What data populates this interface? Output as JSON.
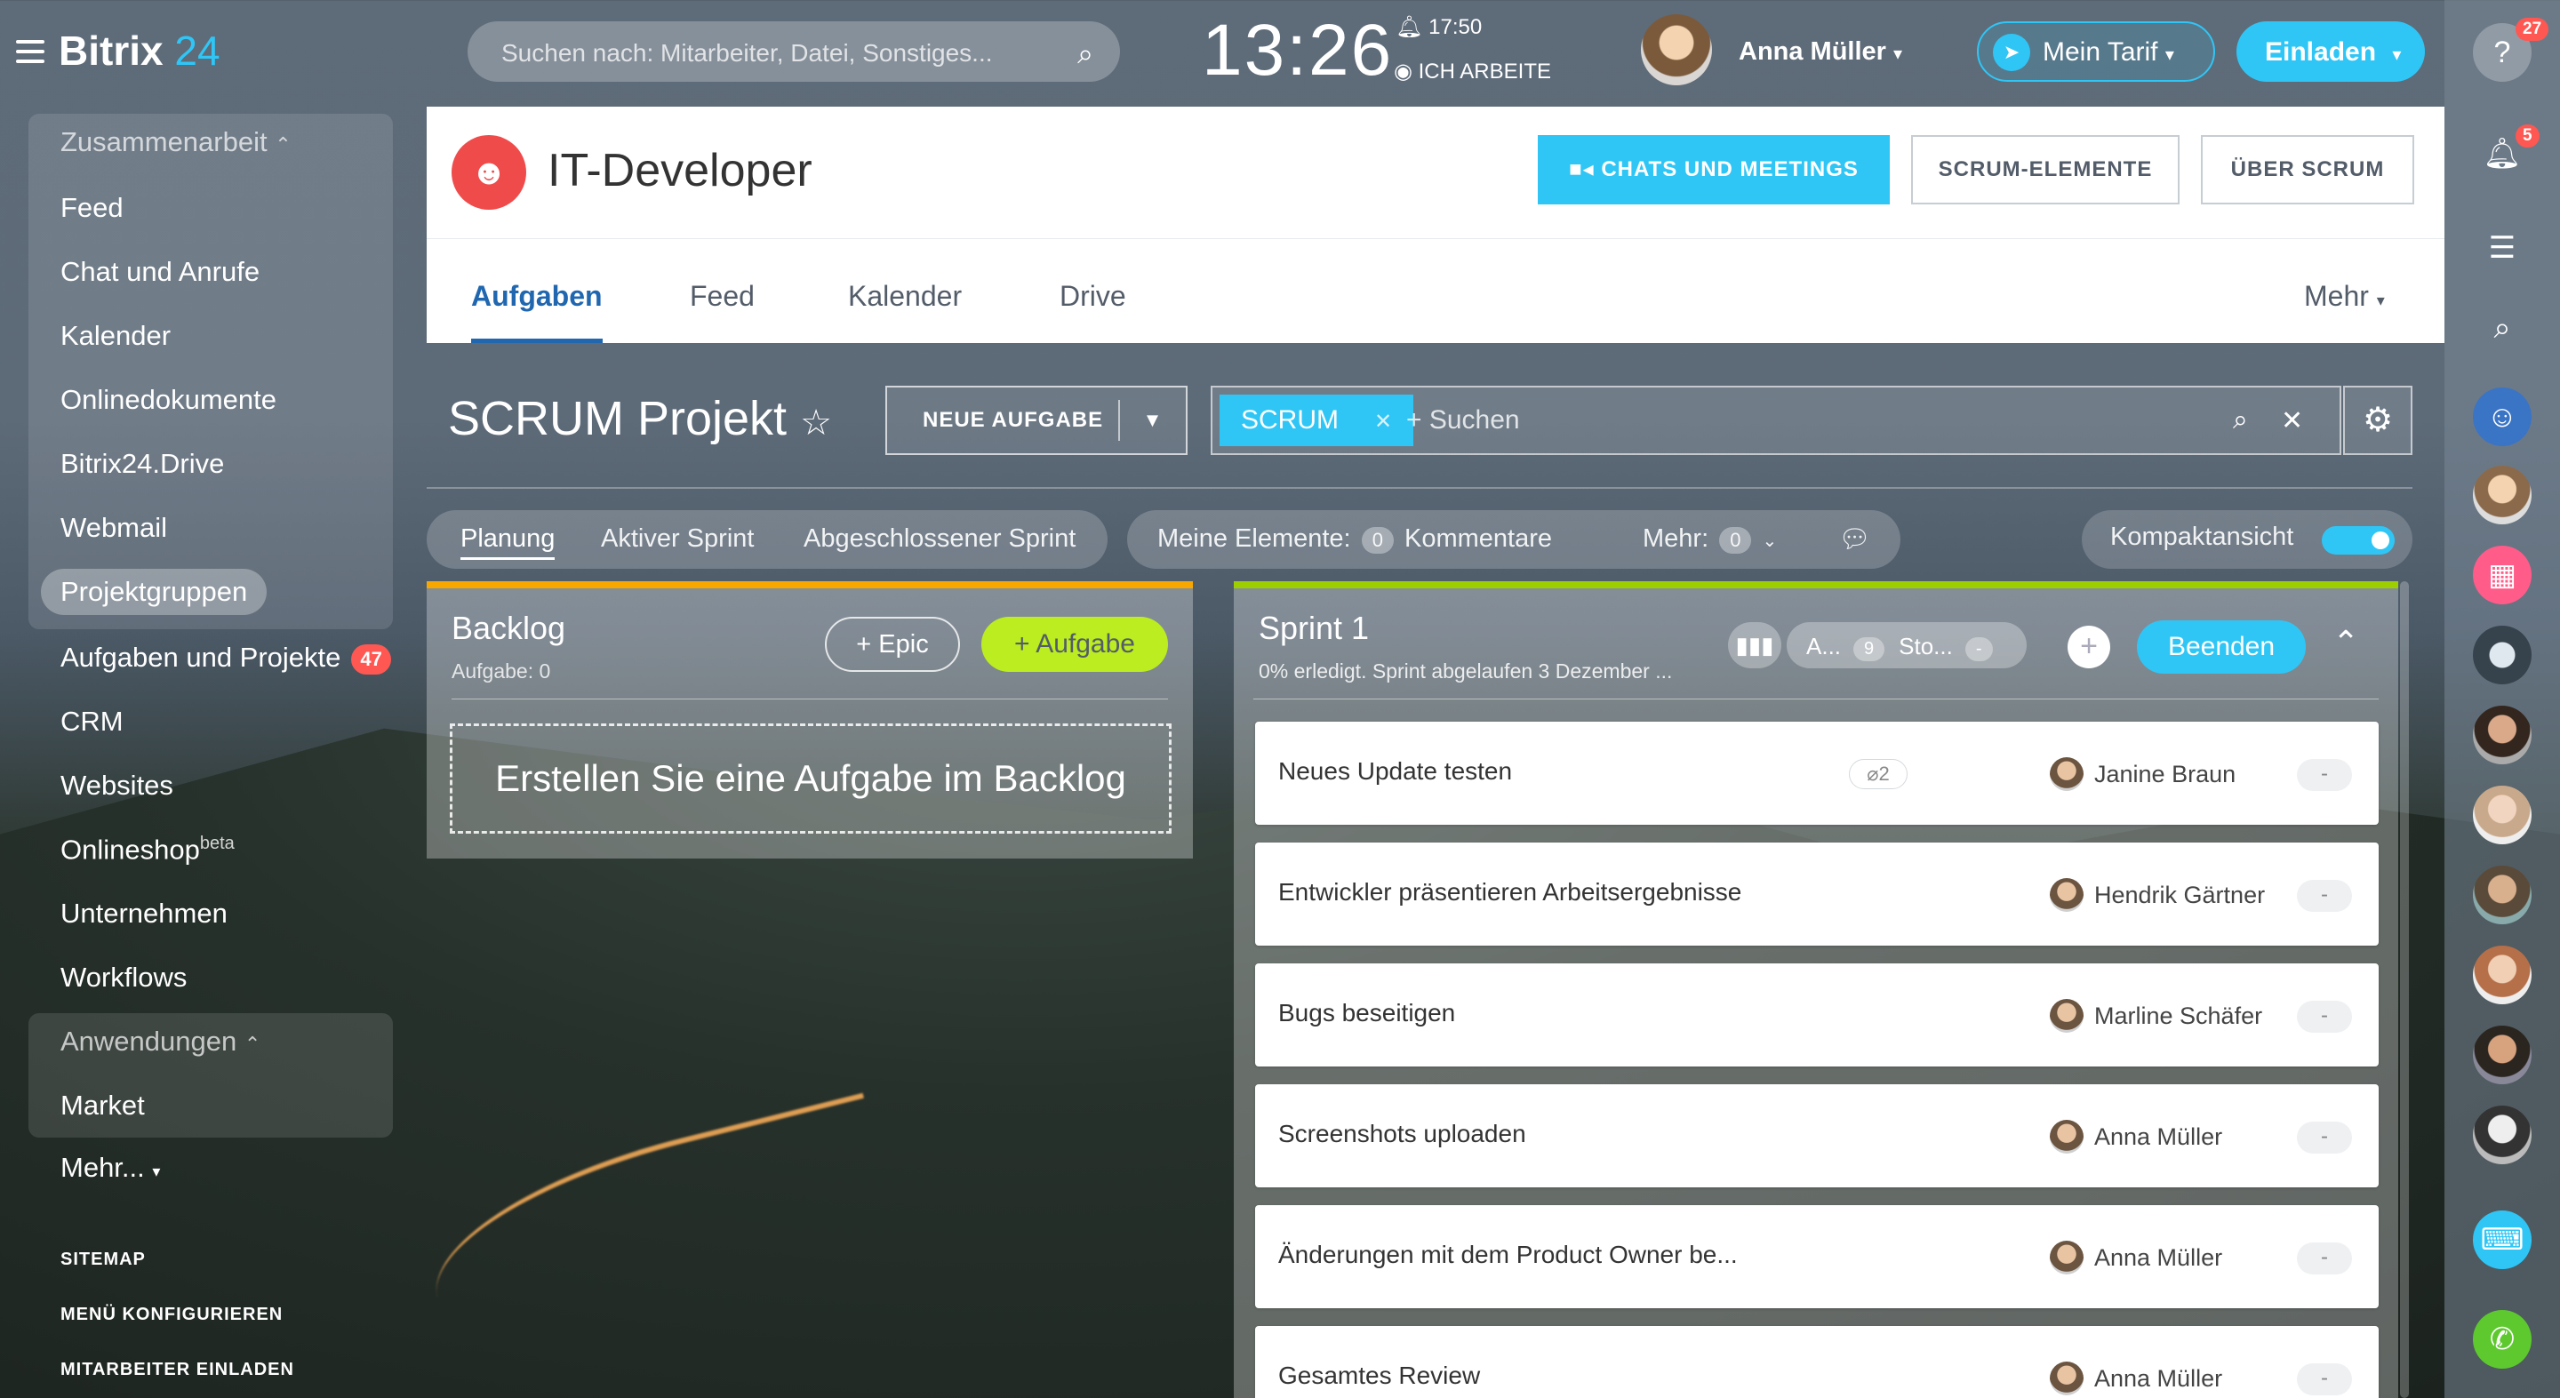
{
  "header": {
    "logo_main": "Bitrix",
    "logo_num": "24",
    "search_placeholder": "Suchen nach: Mitarbeiter, Datei, Sonstiges...",
    "clock": "13:26",
    "alarm": "17:50",
    "work_status": "ICH ARBEITE",
    "user_name": "Anna Müller",
    "tarif": "Mein Tarif",
    "invite": "Einladen"
  },
  "sidebar": {
    "group1": "Zusammenarbeit",
    "items": [
      "Feed",
      "Chat und Anrufe",
      "Kalender",
      "Onlinedokumente",
      "Bitrix24.Drive",
      "Webmail",
      "Projektgruppen",
      "Aufgaben und Projekte",
      "CRM",
      "Websites",
      "Onlineshop",
      "Unternehmen",
      "Workflows"
    ],
    "tasks_badge": "47",
    "onlineshop_sup": "beta",
    "group2": "Anwendungen",
    "market": "Market",
    "more": "Mehr...",
    "sitemap": "SITEMAP",
    "configure": "MENÜ KONFIGURIEREN",
    "invite_staff": "MITARBEITER EINLADEN"
  },
  "rightbar": {
    "help_badge": "27",
    "notif_badge": "5"
  },
  "project": {
    "title": "IT-Developer",
    "btn_chats": "CHATS UND MEETINGS",
    "btn_elements": "SCRUM-ELEMENTE",
    "btn_about": "ÜBER SCRUM",
    "tabs": [
      "Aufgaben",
      "Feed",
      "Kalender",
      "Drive"
    ],
    "more": "Mehr"
  },
  "toolbar": {
    "title": "SCRUM Projekt",
    "new_task": "NEUE AUFGABE",
    "filter_tag": "SCRUM",
    "search_placeholder": "+ Suchen"
  },
  "subtabs": [
    "Planung",
    "Aktiver Sprint",
    "Abgeschlossener Sprint"
  ],
  "counters": {
    "my_label": "Meine Elemente:",
    "my_count": "0",
    "comments": "Kommentare",
    "more_label": "Mehr:",
    "more_count": "0",
    "compact": "Kompaktansicht"
  },
  "backlog": {
    "title": "Backlog",
    "subtitle": "Aufgabe: 0",
    "epic": "+ Epic",
    "add_task": "+ Aufgabe",
    "empty": "Erstellen Sie eine Aufgabe im Backlog"
  },
  "sprint": {
    "title": "Sprint 1",
    "subtitle": "0% erledigt. Sprint abgelaufen 3 Dezember ...",
    "a_label": "A...",
    "a_count": "9",
    "sto_label": "Sto...",
    "sto_count": "-",
    "finish": "Beenden",
    "tasks": [
      {
        "title": "Neues Update testen",
        "assignee": "Janine Braun",
        "points": "-",
        "attachments": "2"
      },
      {
        "title": "Entwickler präsentieren Arbeitsergebnisse",
        "assignee": "Hendrik Gärtner",
        "points": "-"
      },
      {
        "title": "Bugs beseitigen",
        "assignee": "Marline Schäfer",
        "points": "-"
      },
      {
        "title": "Screenshots uploaden",
        "assignee": "Anna Müller",
        "points": "-"
      },
      {
        "title": "Änderungen mit dem Product Owner be...",
        "assignee": "Anna Müller",
        "points": "-"
      },
      {
        "title": "Gesamtes Review",
        "assignee": "Anna Müller",
        "points": "-"
      }
    ]
  },
  "colors": {
    "accent": "#2fc6f6",
    "green": "#bbed21",
    "orange": "#f7a700",
    "badge": "#ff5752"
  }
}
